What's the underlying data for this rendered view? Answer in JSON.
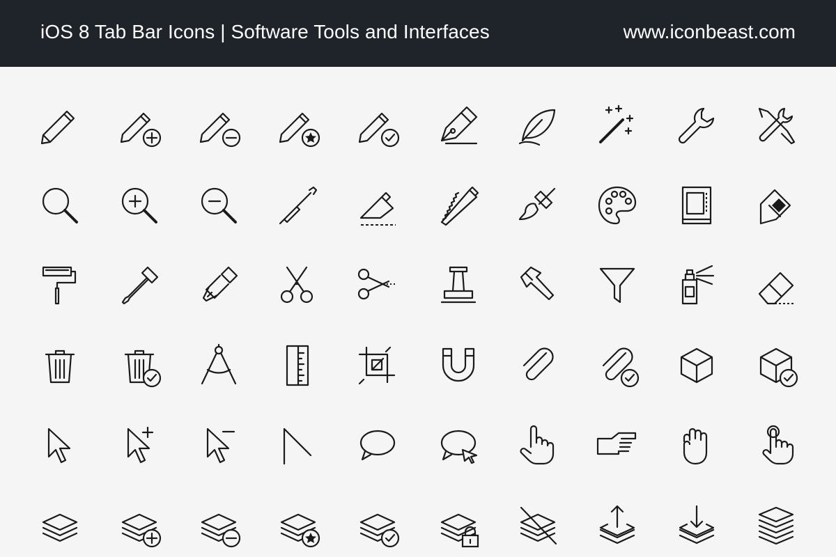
{
  "header": {
    "title": "iOS 8 Tab Bar Icons | Software Tools and Interfaces",
    "site": "www.iconbeast.com"
  },
  "colors": {
    "header_bg": "#1f242b",
    "header_text": "#ffffff",
    "page_bg": "#f5f5f5",
    "icon_stroke": "#1a1a1a"
  },
  "rows": [
    [
      "pencil-icon",
      "pencil-add-icon",
      "pencil-remove-icon",
      "pencil-star-icon",
      "pencil-check-icon",
      "pen-nib-icon",
      "feather-quill-icon",
      "magic-wand-icon",
      "wrench-icon",
      "tools-crossed-icon"
    ],
    [
      "magnifier-icon",
      "zoom-in-icon",
      "zoom-out-icon",
      "screwdriver-icon",
      "utility-knife-icon",
      "saw-icon",
      "paintbrush-icon",
      "palette-icon",
      "frame-icon",
      "paint-bucket-icon"
    ],
    [
      "paint-roller-icon",
      "eyedropper-icon",
      "brush-icon",
      "scissors-icon",
      "scissors-cut-icon",
      "stamp-icon",
      "hammer-icon",
      "filter-funnel-icon",
      "spray-can-icon",
      "eraser-icon"
    ],
    [
      "trash-icon",
      "trash-check-icon",
      "compass-icon",
      "ruler-icon",
      "crop-icon",
      "magnet-icon",
      "paperclip-icon",
      "paperclip-check-icon",
      "cube-icon",
      "cube-check-icon"
    ],
    [
      "cursor-arrow-icon",
      "cursor-add-icon",
      "cursor-remove-icon",
      "angle-icon",
      "speech-bubble-icon",
      "speech-bubble-cursor-icon",
      "hand-pointer-icon",
      "hand-point-right-icon",
      "hand-grab-icon",
      "hand-tap-icon"
    ],
    [
      "layers-icon",
      "layers-add-icon",
      "layers-remove-icon",
      "layers-star-icon",
      "layers-check-icon",
      "layers-lock-icon",
      "layers-hidden-icon",
      "layers-upload-icon",
      "layers-download-icon",
      "layers-stack-icon"
    ]
  ]
}
